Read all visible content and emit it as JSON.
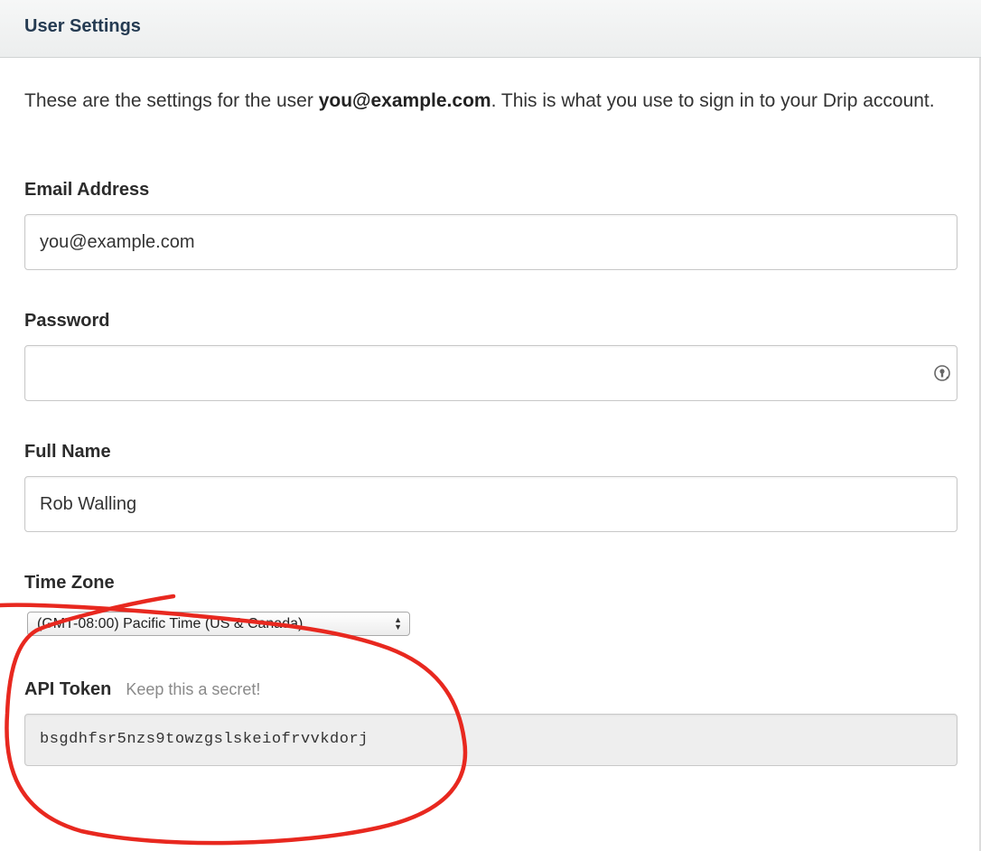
{
  "header": {
    "title": "User Settings"
  },
  "intro": {
    "text_before": "These are the settings for the user ",
    "email": "you@example.com",
    "text_after": ". This is what you use to sign in to your Drip account."
  },
  "fields": {
    "email": {
      "label": "Email Address",
      "value": "you@example.com"
    },
    "password": {
      "label": "Password",
      "value": "",
      "icon": "password-key-icon"
    },
    "full_name": {
      "label": "Full Name",
      "value": "Rob Walling"
    },
    "time_zone": {
      "label": "Time Zone",
      "selected": "(GMT-08:00) Pacific Time (US & Canada)"
    },
    "api_token": {
      "label": "API Token",
      "hint": "Keep this a secret!",
      "value": "bsgdhfsr5nzs9towzgslskeiofrvvkdorj"
    }
  },
  "annotation": {
    "shape": "hand-drawn circle",
    "color": "#e8281f"
  }
}
